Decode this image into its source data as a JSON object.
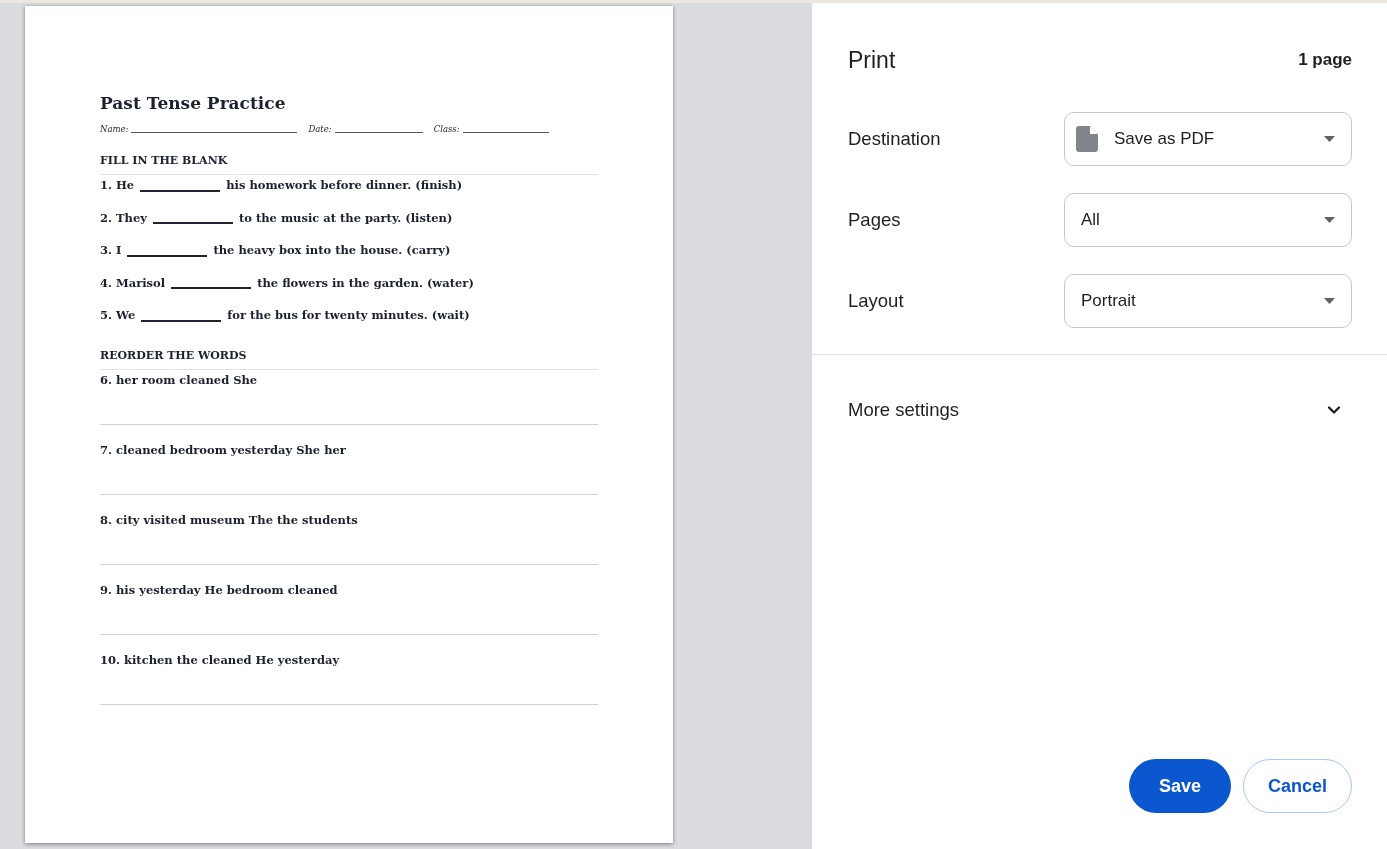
{
  "preview": {
    "page": {
      "title": "Past Tense Practice",
      "header_fields": [
        "Name:",
        "Date:",
        "Class:"
      ],
      "sections": [
        {
          "kind": "fill_in",
          "heading": "FILL IN THE BLANK",
          "items": [
            {
              "before": "1. He",
              "after": "his homework before dinner. (finish)"
            },
            {
              "before": "2. They",
              "after": "to the music at the party. (listen)"
            },
            {
              "before": "3. I",
              "after": "the heavy box into the house. (carry)"
            },
            {
              "before": "4. Marisol",
              "after": "the flowers in the garden. (water)"
            },
            {
              "before": "5. We",
              "after": "for the bus for twenty minutes. (wait)"
            }
          ]
        },
        {
          "kind": "reorder",
          "heading": "REORDER THE WORDS",
          "items": [
            {
              "text": "6. her room cleaned She"
            },
            {
              "text": "7. cleaned bedroom yesterday She her"
            },
            {
              "text": "8. city visited museum The the students"
            },
            {
              "text": "9. his yesterday He bedroom cleaned"
            },
            {
              "text": "10. kitchen the cleaned He yesterday"
            }
          ]
        }
      ]
    }
  },
  "print_panel": {
    "title": "Print",
    "page_count": "1 page",
    "settings": [
      {
        "kind": "destination",
        "label": "Destination",
        "value": "Save as PDF"
      },
      {
        "kind": "select",
        "label": "Pages",
        "value": "All"
      },
      {
        "kind": "select",
        "label": "Layout",
        "value": "Portrait"
      }
    ],
    "more_settings": {
      "label": "More settings",
      "expanded": false
    },
    "buttons": [
      {
        "kind": "primary",
        "label": "Save"
      },
      {
        "kind": "secondary",
        "label": "Cancel"
      }
    ]
  }
}
